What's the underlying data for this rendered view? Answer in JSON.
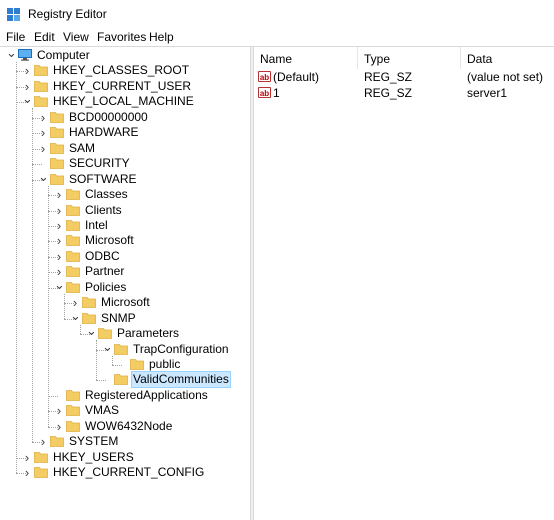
{
  "window": {
    "title": "Registry Editor"
  },
  "menu": [
    "File",
    "Edit",
    "View",
    "Favorites",
    "Help"
  ],
  "tree": [
    {
      "label": "Computer",
      "level": 0,
      "expanded": true,
      "icon": "computer-icon"
    },
    {
      "label": "HKEY_CLASSES_ROOT",
      "level": 1,
      "expanded": false
    },
    {
      "label": "HKEY_CURRENT_USER",
      "level": 1,
      "expanded": false
    },
    {
      "label": "HKEY_LOCAL_MACHINE",
      "level": 1,
      "expanded": true
    },
    {
      "label": "BCD00000000",
      "level": 2,
      "expanded": false
    },
    {
      "label": "HARDWARE",
      "level": 2,
      "expanded": false
    },
    {
      "label": "SAM",
      "level": 2,
      "expanded": false
    },
    {
      "label": "SECURITY",
      "level": 2,
      "expanded": null
    },
    {
      "label": "SOFTWARE",
      "level": 2,
      "expanded": true
    },
    {
      "label": "Classes",
      "level": 3,
      "expanded": false
    },
    {
      "label": "Clients",
      "level": 3,
      "expanded": false
    },
    {
      "label": "Intel",
      "level": 3,
      "expanded": false
    },
    {
      "label": "Microsoft",
      "level": 3,
      "expanded": false
    },
    {
      "label": "ODBC",
      "level": 3,
      "expanded": false
    },
    {
      "label": "Partner",
      "level": 3,
      "expanded": false
    },
    {
      "label": "Policies",
      "level": 3,
      "expanded": true
    },
    {
      "label": "Microsoft",
      "level": 4,
      "expanded": false
    },
    {
      "label": "SNMP",
      "level": 4,
      "expanded": true
    },
    {
      "label": "Parameters",
      "level": 5,
      "expanded": true
    },
    {
      "label": "TrapConfiguration",
      "level": 6,
      "expanded": true
    },
    {
      "label": "public",
      "level": 7,
      "expanded": null
    },
    {
      "label": "ValidCommunities",
      "level": 6,
      "expanded": null,
      "selected": true
    },
    {
      "label": "RegisteredApplications",
      "level": 3,
      "expanded": null
    },
    {
      "label": "VMAS",
      "level": 3,
      "expanded": false
    },
    {
      "label": "WOW6432Node",
      "level": 3,
      "expanded": false
    },
    {
      "label": "SYSTEM",
      "level": 2,
      "expanded": false
    },
    {
      "label": "HKEY_USERS",
      "level": 1,
      "expanded": false
    },
    {
      "label": "HKEY_CURRENT_CONFIG",
      "level": 1,
      "expanded": false
    }
  ],
  "list": {
    "columns": [
      "Name",
      "Type",
      "Data"
    ],
    "rows": [
      {
        "name": "(Default)",
        "type": "REG_SZ",
        "data": "(value not set)",
        "icon": "ab"
      },
      {
        "name": "1",
        "type": "REG_SZ",
        "data": "server1",
        "icon": "ab"
      }
    ]
  },
  "colors": {
    "folder": "#f3cc63",
    "folder_dark": "#e0b040",
    "selection": "#cce8ff",
    "selection_border": "#99d1ff"
  }
}
